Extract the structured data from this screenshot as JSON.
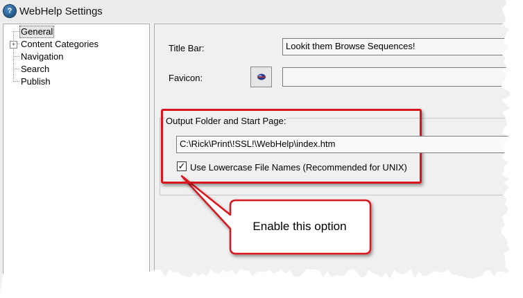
{
  "window": {
    "title": "WebHelp Settings",
    "icon": "help-book-icon"
  },
  "tree": {
    "items": [
      {
        "label": "General",
        "selected": true
      },
      {
        "label": "Content Categories",
        "expandable": true
      },
      {
        "label": "Navigation"
      },
      {
        "label": "Search"
      },
      {
        "label": "Publish"
      }
    ]
  },
  "settings": {
    "title_bar_label": "Title Bar:",
    "title_bar_value": "Lookit them Browse Sequences!",
    "favicon_label": "Favicon:",
    "favicon_value": "",
    "output_label": "Output Folder and Start Page:",
    "output_value": "C:\\Rick\\Print\\!SSL!\\WebHelp\\index.htm",
    "lowercase_label": "Use Lowercase File Names (Recommended for UNIX)",
    "lowercase_checked": true
  },
  "annotation": {
    "text": "Enable this option",
    "highlight_color": "#d8141c"
  }
}
